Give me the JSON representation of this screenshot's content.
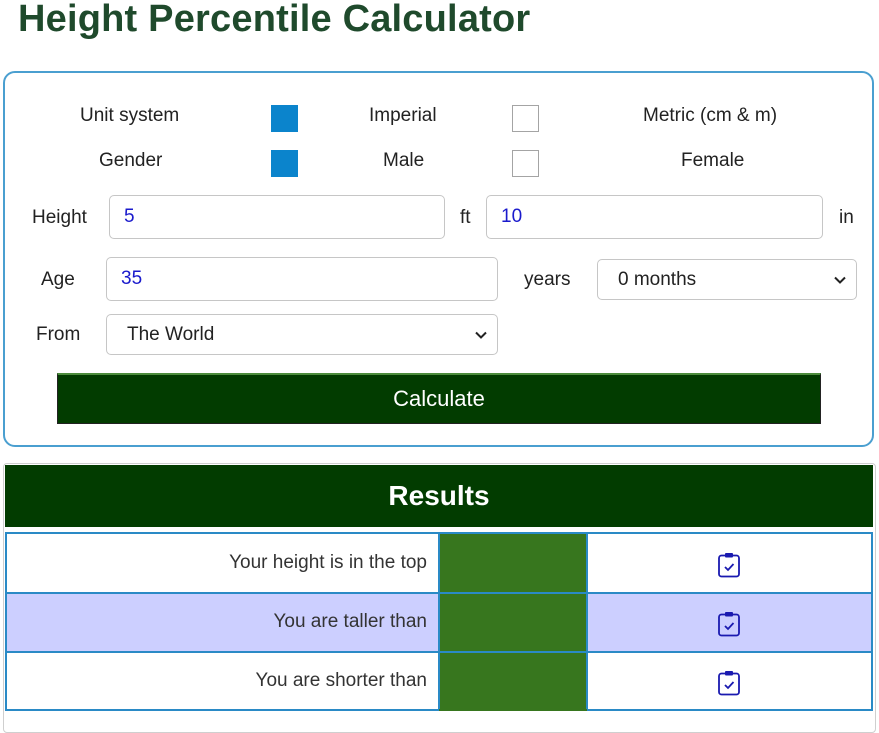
{
  "page": {
    "title": "Height Percentile Calculator"
  },
  "form": {
    "unit_system": {
      "label": "Unit system",
      "option_1": "Imperial",
      "option_2": "Metric (cm & m)",
      "selected": "Imperial"
    },
    "gender": {
      "label": "Gender",
      "option_1": "Male",
      "option_2": "Female",
      "selected": "Male"
    },
    "height": {
      "label": "Height",
      "feet_value": "5",
      "feet_unit": "ft",
      "inches_value": "10",
      "inches_unit": "in"
    },
    "age": {
      "label": "Age",
      "years_value": "35",
      "years_unit": "years",
      "months_selected": "0 months"
    },
    "from": {
      "label": "From",
      "selected": "The World"
    },
    "calculate_label": "Calculate"
  },
  "results": {
    "title": "Results",
    "rows": [
      {
        "label": "Your height is in the top",
        "value": ""
      },
      {
        "label": "You are taller than",
        "value": ""
      },
      {
        "label": "You are shorter than",
        "value": ""
      }
    ]
  },
  "colors": {
    "title": "#1f4a2c",
    "radio_selected": "#0b84cc",
    "dark_green": "#023c00",
    "result_value": "#37761e",
    "alt_row": "#cccfff",
    "border_blue": "#2a8ac6"
  },
  "icons": {
    "copy": "clipboard-check-icon",
    "dropdown": "chevron-down-icon"
  }
}
